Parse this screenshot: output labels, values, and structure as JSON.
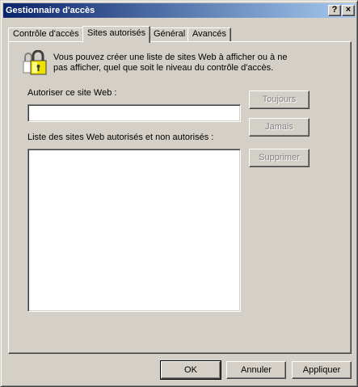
{
  "window": {
    "title": "Gestionnaire d'accès",
    "help_glyph": "?",
    "close_glyph": "×"
  },
  "tabs": [
    {
      "label": "Contrôle d'accès",
      "active": false
    },
    {
      "label": "Sites autorisés",
      "active": true
    },
    {
      "label": "Général",
      "active": false
    },
    {
      "label": "Avancés",
      "active": false
    }
  ],
  "intro": {
    "text": "Vous pouvez créer une liste de sites Web à afficher ou à ne pas afficher, quel que soit le niveau du contrôle d'accès.",
    "icon": "padlock-icon"
  },
  "allow_site": {
    "label": "Autoriser ce site Web :",
    "value": ""
  },
  "list": {
    "label": "Liste des sites Web autorisés et non autorisés :",
    "items": []
  },
  "side_buttons": {
    "always": "Toujours",
    "never": "Jamais",
    "delete": "Supprimer"
  },
  "footer": {
    "ok": "OK",
    "cancel": "Annuler",
    "apply": "Appliquer"
  },
  "colors": {
    "face": "#d4d0c8",
    "title_start": "#0a246a",
    "title_end": "#a6caf0",
    "disabled_text": "#808080"
  }
}
